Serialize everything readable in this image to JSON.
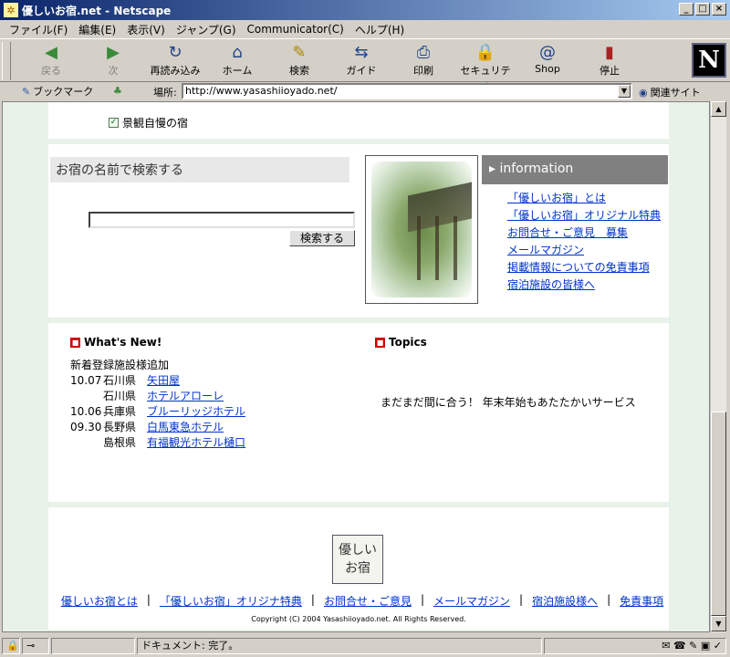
{
  "window": {
    "title": "優しいお宿.net - Netscape",
    "controls": [
      "_",
      "□",
      "×"
    ]
  },
  "menu": [
    "ファイル(F)",
    "編集(E)",
    "表示(V)",
    "ジャンプ(G)",
    "Communicator(C)",
    "ヘルプ(H)"
  ],
  "toolbar": [
    {
      "label": "戻る",
      "icon": "back-icon",
      "glyph": "◀",
      "disabled": true
    },
    {
      "label": "次",
      "icon": "forward-icon",
      "glyph": "▶",
      "disabled": true
    },
    {
      "label": "再読み込み",
      "icon": "reload-icon",
      "glyph": "↻"
    },
    {
      "label": "ホーム",
      "icon": "home-icon",
      "glyph": "⌂"
    },
    {
      "label": "検索",
      "icon": "search-icon",
      "glyph": "✎"
    },
    {
      "label": "ガイド",
      "icon": "guide-icon",
      "glyph": "⇆"
    },
    {
      "label": "印刷",
      "icon": "print-icon",
      "glyph": "⎙"
    },
    {
      "label": "セキュリティ",
      "icon": "lock-icon",
      "glyph": "🔒"
    },
    {
      "label": "Shop",
      "icon": "shop-icon",
      "glyph": "@"
    },
    {
      "label": "停止",
      "icon": "stop-icon",
      "glyph": "▮"
    }
  ],
  "brand_logo": "N",
  "location": {
    "bookmark_label": "ブックマーク",
    "label": "場所:",
    "url": "http://www.yasashiioyado.net/",
    "related_label": "関連サイト"
  },
  "page": {
    "checkboxes": [
      {
        "label": "景観自慢の宿",
        "checked": true
      }
    ],
    "search": {
      "title": "お宿の名前で検索する",
      "value": "",
      "button": "検索する"
    },
    "information": {
      "title": "information",
      "links": [
        "「優しいお宿」とは",
        "「優しいお宿」オリジナル特典",
        "お問合せ・ご意見　募集",
        "メールマガジン",
        "掲載情報についての免責事項",
        "宿泊施設の皆様へ"
      ]
    },
    "whats_new": {
      "title": "What's New!",
      "subtitle": "新着登録施設様追加",
      "items": [
        {
          "date": "10.07",
          "pref": "石川県",
          "name": "矢田屋"
        },
        {
          "date": "",
          "pref": "石川県",
          "name": "ホテルアローレ"
        },
        {
          "date": "10.06",
          "pref": "兵庫県",
          "name": "ブルーリッジホテル"
        },
        {
          "date": "09.30",
          "pref": "長野県",
          "name": "白馬東急ホテル"
        },
        {
          "date": "",
          "pref": "島根県",
          "name": "有福観光ホテル樋口"
        }
      ]
    },
    "topics": {
      "title": "Topics",
      "text": "まだまだ間に合う！ 年末年始もあたたかいサービス"
    },
    "footer": {
      "logo_line1": "優しい",
      "logo_line2": "お宿",
      "links": [
        "優しいお宿とは",
        "「優しいお宿」オリジナ特典",
        "お問合せ・ご意見",
        "メールマガジン",
        "宿泊施設様へ",
        "免責事項"
      ],
      "copyright": "Copyright (C) 2004 Yasashiioyado.net. All Rights Reserved."
    }
  },
  "status": {
    "text": "ドキュメント: 完了。"
  }
}
